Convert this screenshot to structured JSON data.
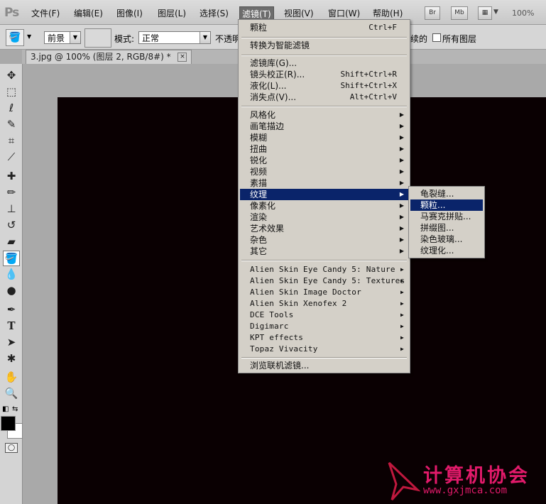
{
  "app": {
    "logo": "Ps",
    "zoom": "100%"
  },
  "menubar": {
    "items": [
      "文件(F)",
      "编辑(E)",
      "图像(I)",
      "图层(L)",
      "选择(S)",
      "滤镜(T)",
      "视图(V)",
      "窗口(W)",
      "帮助(H)"
    ],
    "active": "滤镜(T)",
    "bridge_btn": "Br",
    "minibridge_btn": "Mb"
  },
  "options": {
    "fill_source": "前景",
    "mode_label": "模式:",
    "mode_value": "正常",
    "opacity_label": "不透明",
    "contiguous_partial": "续的",
    "all_layers": "所有图层"
  },
  "document": {
    "tab_title": "3.jpg @ 100% (图层 2, RGB/8#) *",
    "close": "×"
  },
  "filter_menu": {
    "last_filter": {
      "label": "颗粒",
      "shortcut": "Ctrl+F"
    },
    "smart": "转换为智能滤镜",
    "group2": [
      {
        "label": "滤镜库(G)...",
        "shortcut": ""
      },
      {
        "label": "镜头校正(R)...",
        "shortcut": "Shift+Ctrl+R"
      },
      {
        "label": "液化(L)...",
        "shortcut": "Shift+Ctrl+X"
      },
      {
        "label": "消失点(V)...",
        "shortcut": "Alt+Ctrl+V"
      }
    ],
    "group3": [
      "风格化",
      "画笔描边",
      "模糊",
      "扭曲",
      "锐化",
      "视频",
      "素描",
      "纹理",
      "像素化",
      "渲染",
      "艺术效果",
      "杂色",
      "其它"
    ],
    "highlighted": "纹理",
    "plugins": [
      "Alien Skin Eye Candy 5: Nature",
      "Alien Skin Eye Candy 5: Textures",
      "Alien Skin Image Doctor",
      "Alien Skin Xenofex 2",
      "DCE Tools",
      "Digimarc",
      "KPT effects",
      "Topaz Vivacity"
    ],
    "browse": "浏览联机滤镜..."
  },
  "texture_submenu": {
    "items": [
      "龟裂缝...",
      "颗粒...",
      "马赛克拼贴...",
      "拼缀图...",
      "染色玻璃...",
      "纹理化..."
    ],
    "highlighted": "颗粒..."
  },
  "watermark": {
    "title": "计算机协会",
    "url": "www.gxjmca.com"
  },
  "colors": {
    "highlight": "#0a246a",
    "menu_bg": "#d4d0c8",
    "canvas": "#0a0002",
    "watermark": "#e11a6a"
  }
}
